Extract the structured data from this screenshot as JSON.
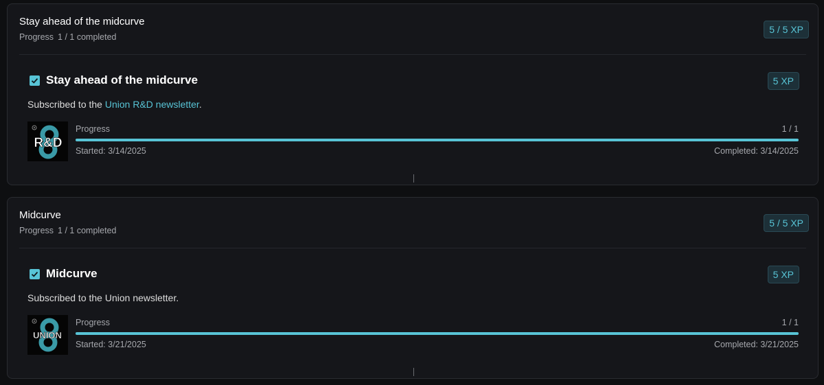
{
  "quests": [
    {
      "title": "Stay ahead of the midcurve",
      "progress_label": "Progress",
      "progress_value": "1 / 1 completed",
      "xp": "5 / 5 XP",
      "task": {
        "title": "Stay ahead of the midcurve",
        "xp": "5 XP",
        "desc_prefix": "Subscribed to the ",
        "desc_link": "Union R&D newsletter",
        "desc_suffix": ".",
        "logo_text": "R&D",
        "progress_label": "Progress",
        "progress_count": "1 / 1",
        "progress_fraction": 1.0,
        "started": "Started: 3/14/2025",
        "completed": "Completed: 3/14/2025"
      }
    },
    {
      "title": "Midcurve",
      "progress_label": "Progress",
      "progress_value": "1 / 1 completed",
      "xp": "5 / 5 XP",
      "task": {
        "title": "Midcurve",
        "xp": "5 XP",
        "desc_prefix": "Subscribed to the Union newsletter.",
        "desc_link": "",
        "desc_suffix": "",
        "logo_text": "UNION",
        "progress_label": "Progress",
        "progress_count": "1 / 1",
        "progress_fraction": 1.0,
        "started": "Started: 3/21/2025",
        "completed": "Completed: 3/21/2025"
      }
    }
  ],
  "colors": {
    "accent": "#58c4d6",
    "card_bg": "#15161a",
    "page_bg": "#0e0f11"
  },
  "icons": {
    "check": "checkbox-checked-icon"
  }
}
